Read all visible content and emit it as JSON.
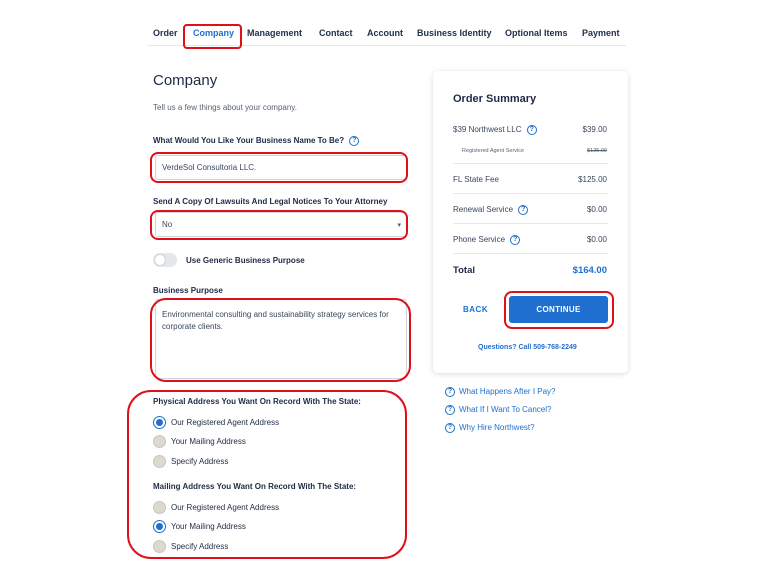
{
  "tabs": [
    "Order",
    "Company",
    "Management",
    "Contact",
    "Account",
    "Business Identity",
    "Optional Items",
    "Payment"
  ],
  "active_tab": "Company",
  "page": {
    "title": "Company",
    "subtitle": "Tell us a few things about your company."
  },
  "business_name": {
    "label": "What Would You Like Your Business Name To Be?",
    "value": "VerdeSol Consultoria LLC."
  },
  "legal_notices": {
    "label": "Send A Copy Of Lawsuits And Legal Notices To Your Attorney",
    "value": "No"
  },
  "generic_purpose": {
    "label": "Use Generic Business Purpose",
    "enabled": false
  },
  "business_purpose": {
    "label": "Business Purpose",
    "value": "Environmental consulting and sustainability strategy services for corporate clients."
  },
  "physical_address": {
    "label": "Physical Address You Want On Record With The State:",
    "options": [
      "Our Registered Agent Address",
      "Your Mailing Address",
      "Specify Address"
    ],
    "selected": "Our Registered Agent Address"
  },
  "mailing_address": {
    "label": "Mailing Address You Want On Record With The State:",
    "options": [
      "Our Registered Agent Address",
      "Your Mailing Address",
      "Specify Address"
    ],
    "selected": "Your Mailing Address"
  },
  "summary": {
    "title": "Order Summary",
    "items": [
      {
        "label": "$39 Northwest LLC",
        "value": "$39.00"
      },
      {
        "label": "Registered Agent Service",
        "value": "$125.00"
      },
      {
        "label": "FL State Fee",
        "value": "$125.00"
      },
      {
        "label": "Renewal Service",
        "value": "$0.00"
      },
      {
        "label": "Phone Service",
        "value": "$0.00"
      }
    ],
    "total_label": "Total",
    "total_value": "$164.00",
    "back_label": "BACK",
    "continue_label": "CONTINUE",
    "questions": "Questions? Call 509-768-2249"
  },
  "faq": [
    "What Happens After I Pay?",
    "What If I Want To Cancel?",
    "Why Hire Northwest?"
  ],
  "colors": {
    "accent": "#1e6fd0",
    "annotation_red": "#e0101a",
    "text_dark": "#1f2a44"
  }
}
